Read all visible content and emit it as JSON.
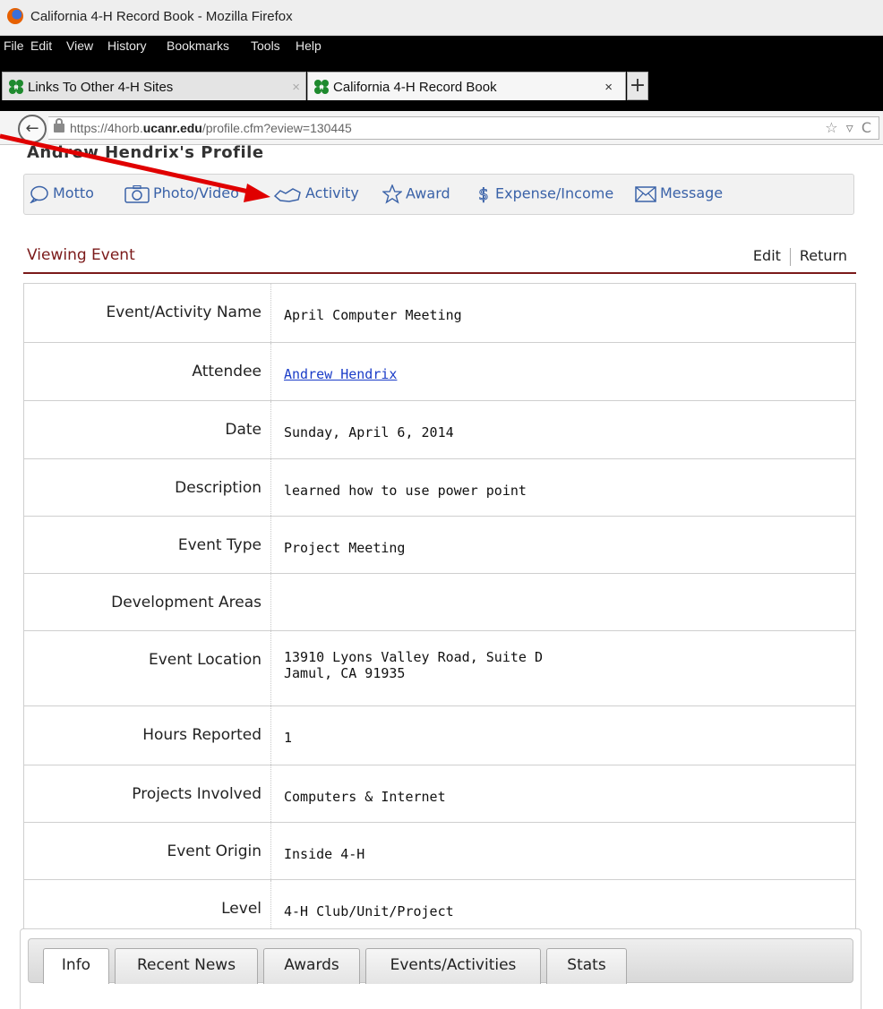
{
  "window": {
    "title": "California 4-H Record Book - Mozilla Firefox"
  },
  "menu": [
    "File",
    "Edit",
    "View",
    "History",
    "Bookmarks",
    "Tools",
    "Help"
  ],
  "tabs": [
    {
      "label": "Links To Other 4-H Sites",
      "close": "×"
    },
    {
      "label": "California 4-H Record Book",
      "close": "×"
    }
  ],
  "new_tab": "+",
  "address": {
    "prefix": "https://4horb.",
    "domain": "ucanr.edu",
    "path": "/profile.cfm?eview=130445",
    "icons": "☆ ▿ C"
  },
  "profile": {
    "title": "Andrew Hendrix's Profile",
    "toolbar": [
      "Motto",
      "Photo/Video",
      "Activity",
      "Award",
      "Expense/Income",
      "Message"
    ]
  },
  "event": {
    "heading": "Viewing Event",
    "edit": "Edit",
    "return": "Return",
    "rows": [
      {
        "label": "Event/Activity Name",
        "value": "April Computer Meeting"
      },
      {
        "label": "Attendee",
        "value": "Andrew Hendrix"
      },
      {
        "label": "Date",
        "value": "Sunday, April 6, 2014"
      },
      {
        "label": "Description",
        "value": "learned how to use power point"
      },
      {
        "label": "Event Type",
        "value": "Project Meeting"
      },
      {
        "label": "Development Areas",
        "value": ""
      },
      {
        "label": "Event Location",
        "value": "13910 Lyons Valley Road, Suite D\nJamul, CA 91935"
      },
      {
        "label": "Hours Reported",
        "value": "1"
      },
      {
        "label": "Projects Involved",
        "value": "Computers & Internet"
      },
      {
        "label": "Event Origin",
        "value": "Inside 4-H"
      },
      {
        "label": "Level",
        "value": "4-H Club/Unit/Project"
      }
    ]
  },
  "bottom_tabs": [
    "Info",
    "Recent News",
    "Awards",
    "Events/Activities",
    "Stats"
  ],
  "colors": {
    "accent": "#7b1a1a",
    "link": "#1a3cc8",
    "toolbar_text": "#3a62a8",
    "arrow": "#e00000"
  }
}
